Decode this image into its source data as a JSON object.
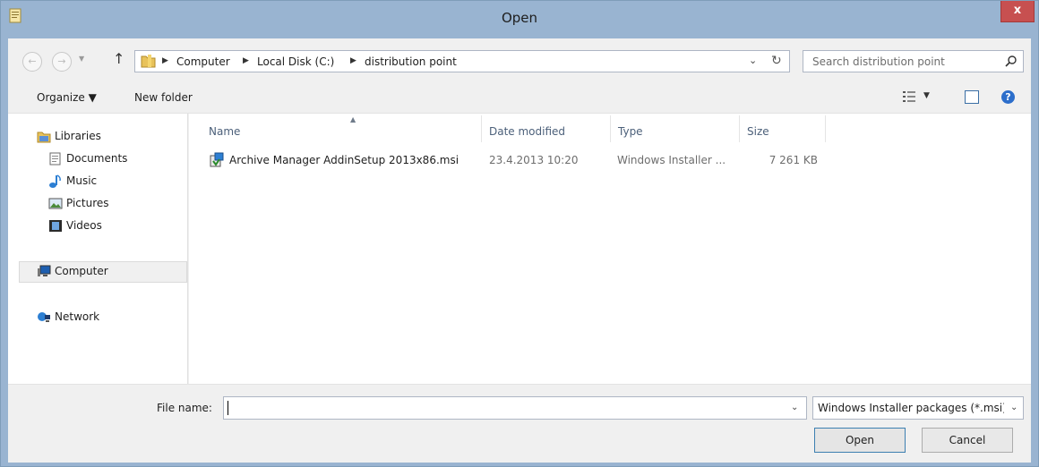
{
  "window": {
    "title": "Open",
    "close_label": "x"
  },
  "nav": {
    "breadcrumbs": [
      "Computer",
      "Local Disk (C:)",
      "distribution point"
    ],
    "search_placeholder": "Search distribution point"
  },
  "toolbar": {
    "organize_label": "Organize ▼",
    "new_folder_label": "New folder",
    "help_label": "?"
  },
  "sidebar": {
    "items": [
      {
        "label": "Libraries",
        "icon": "libraries-icon"
      },
      {
        "label": "Documents",
        "icon": "documents-icon"
      },
      {
        "label": "Music",
        "icon": "music-icon"
      },
      {
        "label": "Pictures",
        "icon": "pictures-icon"
      },
      {
        "label": "Videos",
        "icon": "videos-icon"
      },
      {
        "label": "Computer",
        "icon": "computer-icon"
      },
      {
        "label": "Network",
        "icon": "network-icon"
      }
    ]
  },
  "filelist": {
    "columns": [
      "Name",
      "Date modified",
      "Type",
      "Size"
    ],
    "rows": [
      {
        "name": "Archive Manager AddinSetup 2013x86.msi",
        "date": "23.4.2013 10:20",
        "type": "Windows Installer ...",
        "size": "7 261 KB"
      }
    ]
  },
  "bottom": {
    "file_name_label": "File name:",
    "file_name_value": "",
    "filter_value": "Windows Installer packages (*.msi)",
    "open_label": "Open",
    "cancel_label": "Cancel"
  },
  "colors": {
    "frame": "#99b4d1",
    "close": "#c75050",
    "panel": "#f0f0f0"
  }
}
